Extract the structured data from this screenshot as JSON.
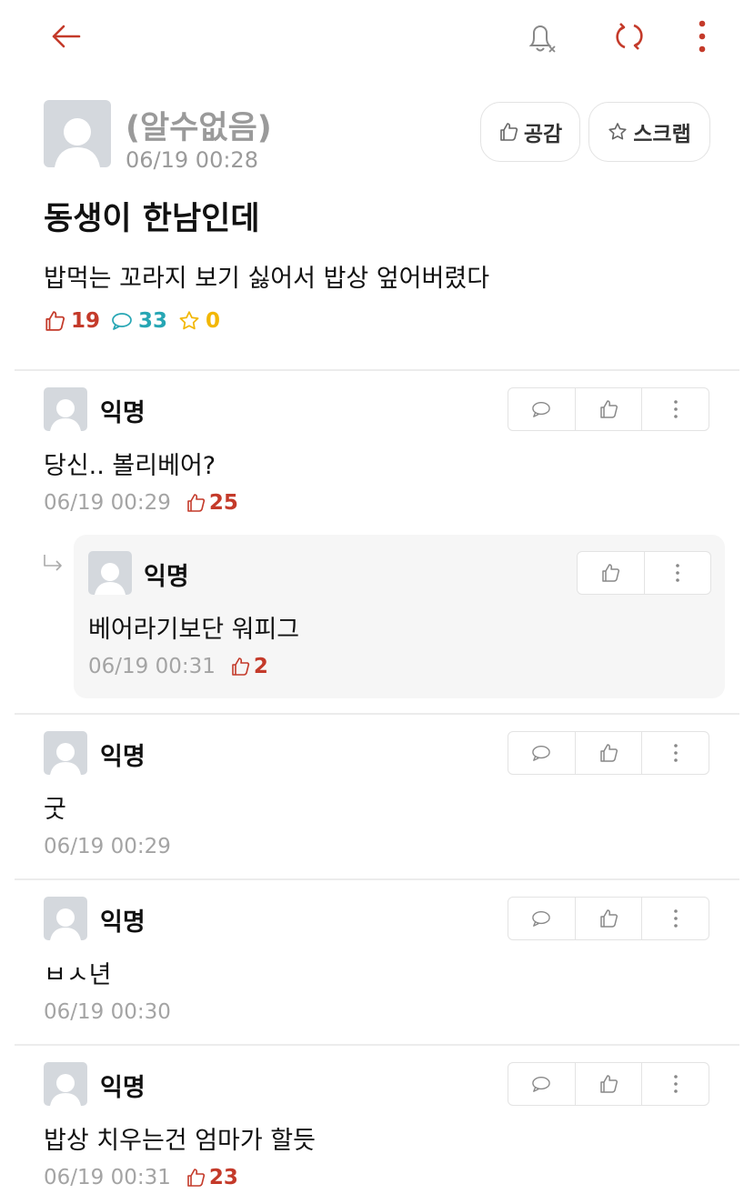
{
  "post": {
    "author": "(알수없음)",
    "time": "06/19 00:28",
    "empathy_label": "공감",
    "scrap_label": "스크랩",
    "title": "동생이 한남인데",
    "body": "밥먹는 꼬라지 보기 싫어서 밥상 엎어버렸다",
    "stats": {
      "likes": "19",
      "comments": "33",
      "scraps": "0"
    }
  },
  "comments": [
    {
      "author": "익명",
      "text": "당신.. 볼리베어?",
      "time": "06/19 00:29",
      "likes": "25",
      "reply": {
        "author": "익명",
        "text": "베어라기보단 워피그",
        "time": "06/19 00:31",
        "likes": "2"
      }
    },
    {
      "author": "익명",
      "text": "굿",
      "time": "06/19 00:29"
    },
    {
      "author": "익명",
      "text": "ㅂㅅ년",
      "time": "06/19 00:30"
    },
    {
      "author": "익명",
      "text": "밥상 치우는건 엄마가 할듯",
      "time": "06/19 00:31",
      "likes": "23"
    }
  ],
  "colors": {
    "accent": "#c43a2a",
    "comment": "#26a6b4",
    "scrap": "#f2b705",
    "meta": "#a4a4a4"
  }
}
